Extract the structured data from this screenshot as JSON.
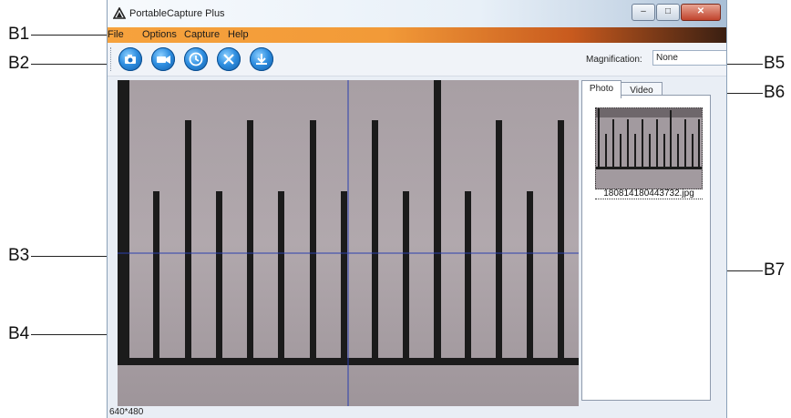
{
  "window": {
    "title": "PortableCapture Plus"
  },
  "menu": {
    "items": [
      "File",
      "Options",
      "Capture",
      "Help"
    ]
  },
  "toolbar": {
    "buttons": [
      "camera-snapshot-icon",
      "video-record-icon",
      "timer-icon",
      "fullscreen-icon",
      "download-icon"
    ]
  },
  "magnification": {
    "label": "Magnification:",
    "value": "None"
  },
  "tabs": [
    "Photo",
    "Video"
  ],
  "gallery": {
    "items": [
      {
        "filename": "180814180443732.jpg"
      }
    ]
  },
  "status": {
    "resolution": "640*480"
  },
  "callouts": {
    "B1": "B1",
    "B2": "B2",
    "B3": "B3",
    "B4": "B4",
    "B5": "B5",
    "B6": "B6",
    "B7": "B7"
  },
  "colors": {
    "menubar_accent": "#f29a38",
    "ruler_background": "#a59ca1",
    "ruler_marks": "#1b1b1b",
    "crosshair": "#2b3fae"
  }
}
